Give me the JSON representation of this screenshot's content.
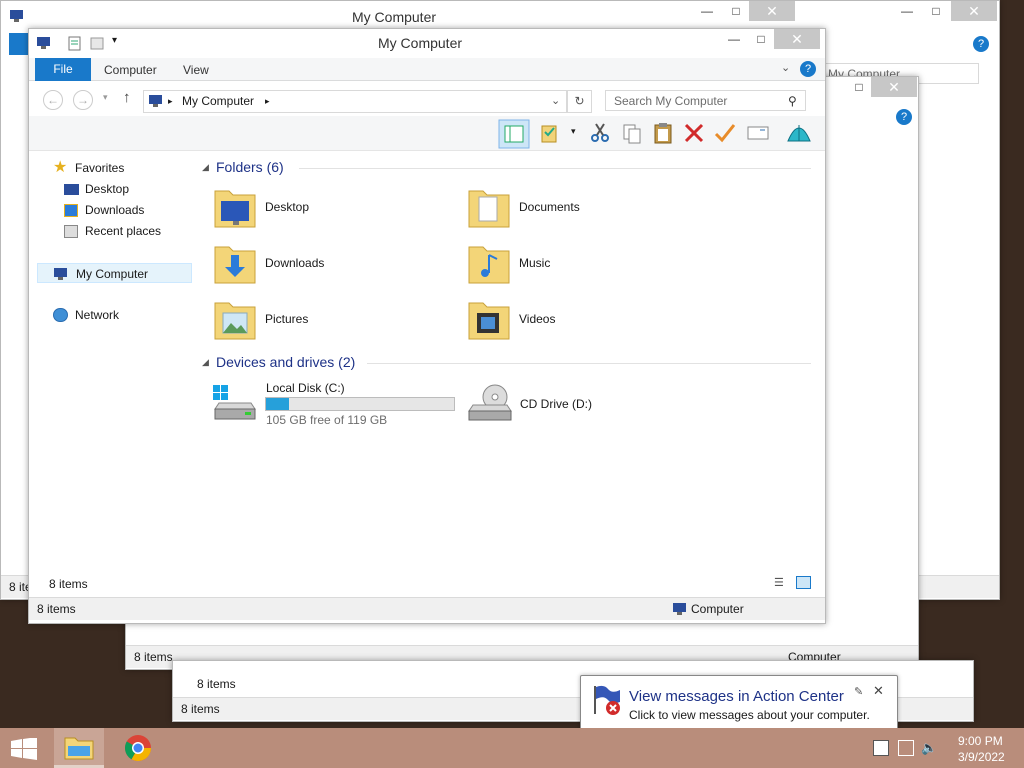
{
  "window": {
    "title": "My Computer",
    "tabs": {
      "file": "File",
      "computer": "Computer",
      "view": "View"
    },
    "address": {
      "path": "My Computer"
    },
    "search": {
      "placeholder": "Search My Computer"
    },
    "nav": {
      "favorites": "Favorites",
      "desktop": "Desktop",
      "downloads": "Downloads",
      "recent": "Recent places",
      "my_computer": "My Computer",
      "network": "Network"
    },
    "folders_header": "Folders (6)",
    "folders": [
      {
        "label": "Desktop",
        "icon": "desktop-folder-icon"
      },
      {
        "label": "Documents",
        "icon": "documents-folder-icon"
      },
      {
        "label": "Downloads",
        "icon": "downloads-folder-icon"
      },
      {
        "label": "Music",
        "icon": "music-folder-icon"
      },
      {
        "label": "Pictures",
        "icon": "pictures-folder-icon"
      },
      {
        "label": "Videos",
        "icon": "videos-folder-icon"
      }
    ],
    "drives_header": "Devices and drives (2)",
    "drives": [
      {
        "label": "Local Disk (C:)",
        "free": "105 GB free of 119 GB",
        "used_fraction": 0.12
      },
      {
        "label": "CD Drive (D:)"
      }
    ],
    "status_count": "8 items",
    "status_computer": "Computer"
  },
  "background_windows": {
    "title": "My Computer",
    "status_count": "8 items",
    "status_computer": "Computer",
    "search_placeholder": "My Computer"
  },
  "toast": {
    "title": "View messages in Action Center",
    "body": "Click to view messages about your computer."
  },
  "clock": {
    "time": "9:00 PM",
    "date": "3/9/2022"
  },
  "colors": {
    "accent": "#1979ca",
    "taskbar": "#b98d7b",
    "header": "#1e3287"
  }
}
